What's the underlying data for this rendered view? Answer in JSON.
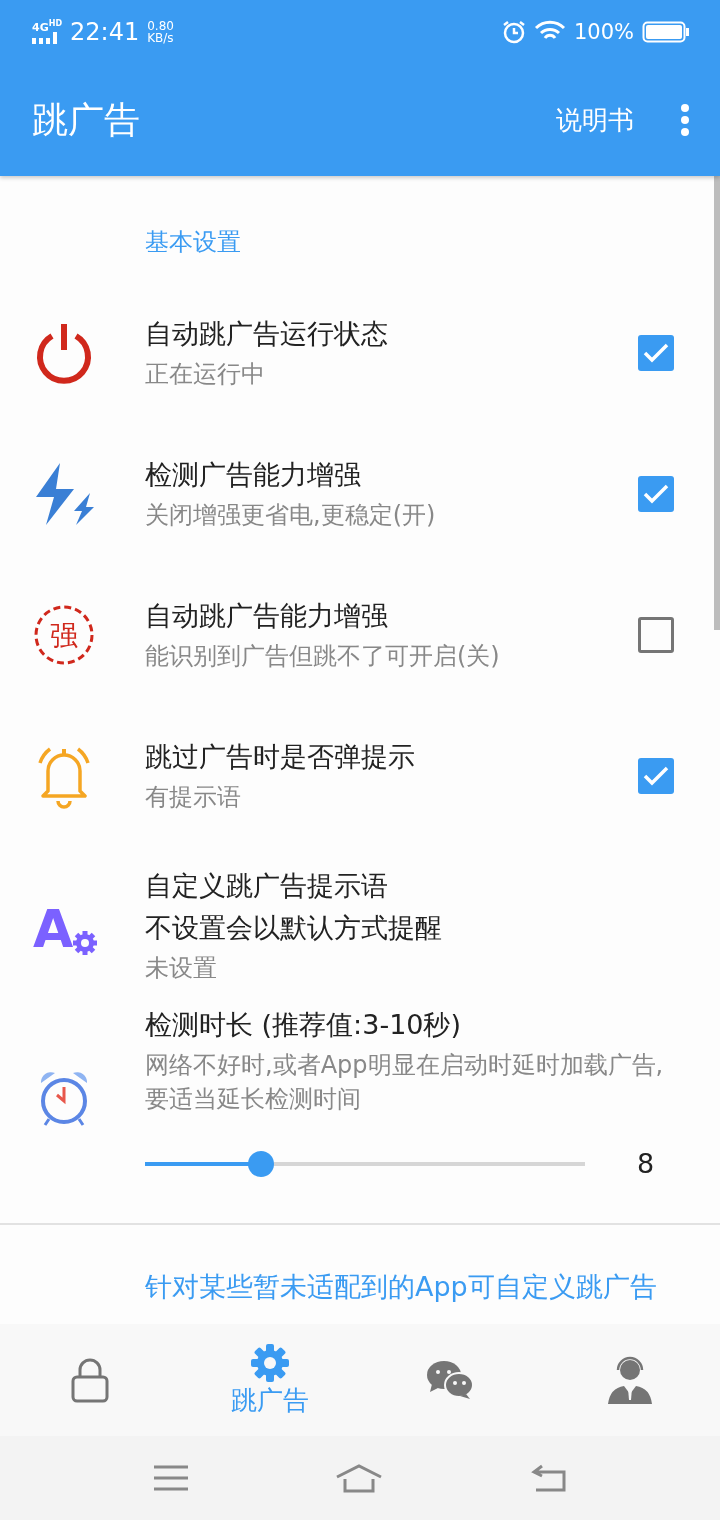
{
  "status_bar": {
    "network": "4G",
    "network_badge": "HD",
    "time": "22:41",
    "speed": "0.80",
    "speed_unit": "KB/s",
    "battery": "100%"
  },
  "app_bar": {
    "title": "跳广告",
    "action": "说明书"
  },
  "section": {
    "title": "基本设置"
  },
  "settings": [
    {
      "kind": "checkbox",
      "title": "自动跳广告运行状态",
      "subtitle": "正在运行中",
      "checked": true
    },
    {
      "kind": "checkbox",
      "title": "检测广告能力增强",
      "subtitle": "关闭增强更省电,更稳定(开)",
      "checked": true
    },
    {
      "kind": "checkbox",
      "icon_text": "强",
      "title": "自动跳广告能力增强",
      "subtitle": "能识别到广告但跳不了可开启(关)",
      "checked": false
    },
    {
      "kind": "checkbox",
      "title": "跳过广告时是否弹提示",
      "subtitle": "有提示语",
      "checked": true
    },
    {
      "kind": "text",
      "icon_text": "A",
      "title_lines": [
        "自定义跳广告提示语",
        "不设置会以默认方式提醒"
      ],
      "subtitle": "未设置"
    },
    {
      "kind": "slider",
      "title": "检测时长 (推荐值:3-10秒)",
      "subtitle": "网络不好时,或者App明显在启动时延时加载广告,要适当延长检测时间",
      "level": 0.264,
      "reading": "8"
    }
  ],
  "next_section": {
    "title": "针对某些暂未适配到的App可自定义跳广告"
  },
  "bottom_nav": [
    {
      "selected": false
    },
    {
      "label": "跳广告",
      "selected": true
    },
    {
      "selected": false
    },
    {
      "selected": false
    }
  ]
}
